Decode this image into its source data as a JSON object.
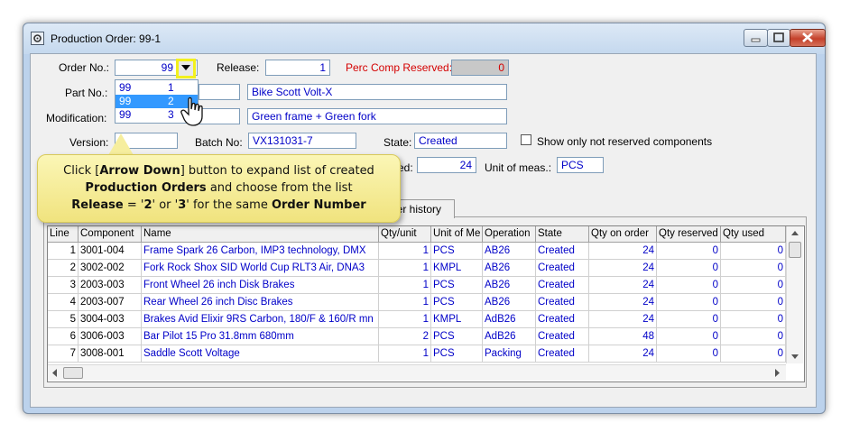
{
  "window": {
    "title": "Production Order: 99-1"
  },
  "form": {
    "order_no_label": "Order No.:",
    "order_no_value": "99",
    "release_label": "Release:",
    "release_value": "1",
    "perc_comp_label": "Perc Comp Reserved:",
    "perc_comp_value": "0",
    "part_no_label": "Part No.:",
    "part_name": "Bike Scott Volt-X",
    "modification_label": "Modification:",
    "modification_value": "Green frame + Green fork",
    "version_label": "Version:",
    "batch_label": "Batch No:",
    "batch_value": "VX131031-7",
    "state_label": "State:",
    "state_value": "Created",
    "show_only_label": "Show only not reserved components",
    "qty_label_partial": "ed:",
    "qty_value": "24",
    "unit_label": "Unit of meas.:",
    "unit_value": "PCS",
    "tab_label": "der history"
  },
  "dropdown": {
    "items": [
      {
        "order": "99",
        "release": "1"
      },
      {
        "order": "99",
        "release": "2"
      },
      {
        "order": "99",
        "release": "3"
      }
    ],
    "selected_index": 1
  },
  "callout": {
    "line1_pre": "Click [",
    "line1_bold": "Arrow Down",
    "line1_post": "] button to expand list of created",
    "line2_bold": "Production  Orders",
    "line2_post": " and choose from the list",
    "line3_bold1": "Release",
    "line3_mid1": " = '",
    "line3_b2": "2",
    "line3_mid2": "' or '",
    "line3_b3": "3",
    "line3_mid3": "' for the same ",
    "line3_bold4": "Order Number"
  },
  "table": {
    "columns": [
      "Line",
      "Component",
      "Name",
      "Qty/unit",
      "Unit of Me",
      "Operation",
      "State",
      "Qty on order",
      "Qty reserved",
      "Qty used"
    ],
    "rows": [
      {
        "line": "1",
        "component": "3001-004",
        "name": "Frame Spark 26 Carbon, IMP3 technology, DMX",
        "qty_unit": "1",
        "unit": "PCS",
        "operation": "AB26",
        "state": "Created",
        "qty_order": "24",
        "qty_reserved": "0",
        "qty_used": "0"
      },
      {
        "line": "2",
        "component": "3002-002",
        "name": "Fork Rock Shox SID World Cup RLT3 Air, DNA3",
        "qty_unit": "1",
        "unit": "KMPL",
        "operation": "AB26",
        "state": "Created",
        "qty_order": "24",
        "qty_reserved": "0",
        "qty_used": "0"
      },
      {
        "line": "3",
        "component": "2003-003",
        "name": "Front Wheel 26 inch Disk Brakes",
        "qty_unit": "1",
        "unit": "PCS",
        "operation": "AB26",
        "state": "Created",
        "qty_order": "24",
        "qty_reserved": "0",
        "qty_used": "0"
      },
      {
        "line": "4",
        "component": "2003-007",
        "name": "Rear Wheel 26 inch Disc Brakes",
        "qty_unit": "1",
        "unit": "PCS",
        "operation": "AB26",
        "state": "Created",
        "qty_order": "24",
        "qty_reserved": "0",
        "qty_used": "0"
      },
      {
        "line": "5",
        "component": "3004-003",
        "name": "Brakes Avid Elixir 9RS Carbon, 180/F & 160/R mn",
        "qty_unit": "1",
        "unit": "KMPL",
        "operation": "AdB26",
        "state": "Created",
        "qty_order": "24",
        "qty_reserved": "0",
        "qty_used": "0"
      },
      {
        "line": "6",
        "component": "3006-003",
        "name": "Bar Pilot 15 Pro 31.8mm 680mm",
        "qty_unit": "2",
        "unit": "PCS",
        "operation": "AdB26",
        "state": "Created",
        "qty_order": "48",
        "qty_reserved": "0",
        "qty_used": "0"
      },
      {
        "line": "7",
        "component": "3008-001",
        "name": "Saddle Scott Voltage",
        "qty_unit": "1",
        "unit": "PCS",
        "operation": "Packing",
        "state": "Created",
        "qty_order": "24",
        "qty_reserved": "0",
        "qty_used": "0"
      }
    ]
  },
  "colors": {
    "value_text": "#0000c8",
    "label_red": "#d40000",
    "selection": "#3399ff",
    "highlight_border": "#f2f01e",
    "callout_bg": "#f6ee9e"
  },
  "icons": [
    "app-gear-icon",
    "minimize-icon",
    "maximize-icon",
    "close-icon",
    "chevron-down-icon",
    "hand-cursor-icon",
    "scroll-up-icon",
    "scroll-down-icon",
    "scroll-left-icon",
    "scroll-right-icon"
  ]
}
